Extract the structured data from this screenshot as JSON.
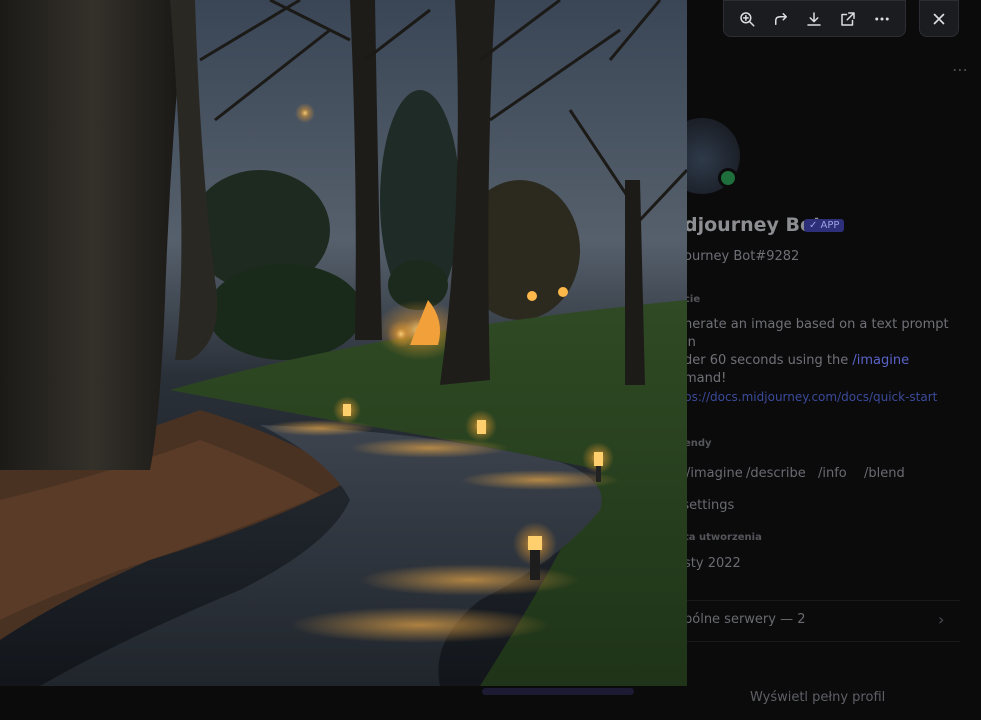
{
  "profile": {
    "bot_name": "djourney Bot",
    "bot_badge": "✓ APP",
    "bot_tag": "ourney Bot#9282",
    "section_about": "cie",
    "about_text_1": "nerate an image based on a text prompt in",
    "about_text_2": "der 60 seconds using the ",
    "about_command": "/imagine",
    "about_text_3": "mand!",
    "link": "ps://docs.midjourney.com/docs/quick-start",
    "section_commands": "endy",
    "commands": [
      "/imagine",
      "/describe",
      "/info",
      "/blend"
    ],
    "command_settings": "/settings",
    "section_created": "ta utworzenia",
    "created_date": "sty 2022",
    "mutual_servers": "pólne serwery — 2",
    "view_full_profile": "Wyświetl pełny profil"
  },
  "toolbar": {
    "icons": [
      "zoom-in-icon",
      "share-forward-icon",
      "download-icon",
      "open-external-icon",
      "more-options-icon"
    ],
    "close_icon": "close-icon"
  },
  "colors": {
    "toolbar_bg": "#1b1c1f",
    "icon_color": "#dbdee1",
    "backdrop": "#060607"
  }
}
